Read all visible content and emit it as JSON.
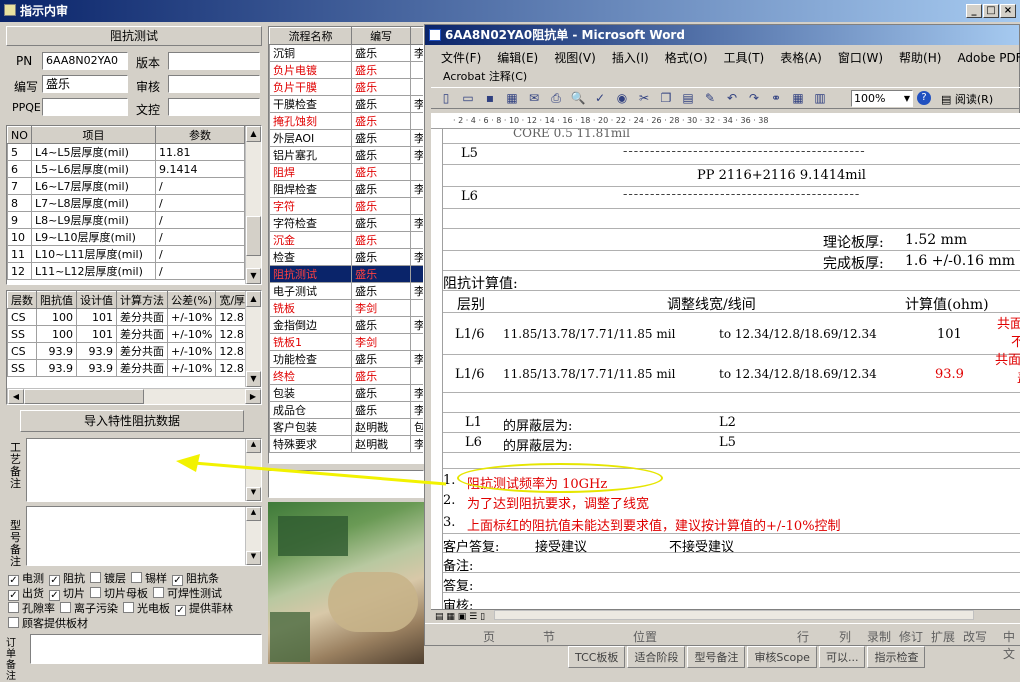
{
  "app": {
    "title": "指示内审"
  },
  "left": {
    "section_title": "阻抗测试",
    "fields": {
      "pn_label": "PN",
      "pn_value": "6AA8N02YA0",
      "version_label": "版本",
      "version_value": "",
      "writer_label": "编写",
      "writer_value": "盛乐",
      "review_label": "审核",
      "review_value": "",
      "ppqe_label": "PPQE",
      "ppqe_value": "",
      "docctrl_label": "文控",
      "docctrl_value": ""
    },
    "params_table": {
      "headers": [
        "NO",
        "项目",
        "参数"
      ],
      "rows": [
        [
          "5",
          "L4~L5层厚度(mil)",
          "11.81"
        ],
        [
          "6",
          "L5~L6层厚度(mil)",
          "9.1414"
        ],
        [
          "7",
          "L6~L7层厚度(mil)",
          "/"
        ],
        [
          "8",
          "L7~L8层厚度(mil)",
          "/"
        ],
        [
          "9",
          "L8~L9层厚度(mil)",
          "/"
        ],
        [
          "10",
          "L9~L10层厚度(mil)",
          "/"
        ],
        [
          "11",
          "L10~L11层厚度(mil)",
          "/"
        ],
        [
          "12",
          "L11~L12层厚度(mil)",
          "/"
        ]
      ]
    },
    "imp_table": {
      "headers": [
        "层数",
        "阻抗值",
        "设计值",
        "计算方法",
        "公差(%)",
        "宽/厚"
      ],
      "rows": [
        [
          "CS",
          "100",
          "101",
          "差分共面",
          "+/-10%",
          "12.8"
        ],
        [
          "SS",
          "100",
          "101",
          "差分共面",
          "+/-10%",
          "12.8"
        ],
        [
          "CS",
          "93.9",
          "93.9",
          "差分共面",
          "+/-10%",
          "12.8"
        ],
        [
          "SS",
          "93.9",
          "93.9",
          "差分共面",
          "+/-10%",
          "12.8"
        ]
      ]
    },
    "import_button": "导入特性阻抗数据",
    "remark1_label": "工艺备注",
    "remark2_label": "型号备注",
    "checks": [
      {
        "label": "电测",
        "checked": true
      },
      {
        "label": "阻抗",
        "checked": true
      },
      {
        "label": "镀层",
        "checked": false
      },
      {
        "label": "锡样",
        "checked": false
      },
      {
        "label": "阻抗条",
        "checked": true
      },
      {
        "label": "出货",
        "checked": true
      },
      {
        "label": "切片",
        "checked": true
      },
      {
        "label": "切片母板",
        "checked": false
      },
      {
        "label": "可焊性测试",
        "checked": false
      },
      {
        "label": "孔隙率",
        "checked": false
      },
      {
        "label": "离子污染",
        "checked": false
      },
      {
        "label": "光电板",
        "checked": false
      },
      {
        "label": "提供菲林",
        "checked": true
      },
      {
        "label": "顾客提供板材",
        "checked": false
      }
    ],
    "order_label": "订单备注"
  },
  "flow": {
    "headers": [
      "流程名称",
      "编写",
      ""
    ],
    "rows": [
      {
        "name": "沉铜",
        "writer": "盛乐",
        "x": "李",
        "red": false
      },
      {
        "name": "负片电镀",
        "writer": "盛乐",
        "x": "",
        "red": true
      },
      {
        "name": "负片干膜",
        "writer": "盛乐",
        "x": "",
        "red": true
      },
      {
        "name": "干膜检查",
        "writer": "盛乐",
        "x": "李",
        "red": false
      },
      {
        "name": "掩孔蚀刻",
        "writer": "盛乐",
        "x": "",
        "red": true
      },
      {
        "name": "外层AOI",
        "writer": "盛乐",
        "x": "李",
        "red": false
      },
      {
        "name": "铝片塞孔",
        "writer": "盛乐",
        "x": "李",
        "red": false
      },
      {
        "name": "阻焊",
        "writer": "盛乐",
        "x": "",
        "red": true
      },
      {
        "name": "阻焊检查",
        "writer": "盛乐",
        "x": "李",
        "red": false
      },
      {
        "name": "字符",
        "writer": "盛乐",
        "x": "",
        "red": true
      },
      {
        "name": "字符检查",
        "writer": "盛乐",
        "x": "李",
        "red": false
      },
      {
        "name": "沉金",
        "writer": "盛乐",
        "x": "",
        "red": true
      },
      {
        "name": "检查",
        "writer": "盛乐",
        "x": "李",
        "red": false
      },
      {
        "name": "阻抗测试",
        "writer": "盛乐",
        "x": "",
        "red": true,
        "selected": true
      },
      {
        "name": "电子测试",
        "writer": "盛乐",
        "x": "李",
        "red": false
      },
      {
        "name": "铣板",
        "writer": "李剑",
        "x": "",
        "red": true
      },
      {
        "name": "金指倒边",
        "writer": "盛乐",
        "x": "李",
        "red": false
      },
      {
        "name": "铣板1",
        "writer": "李剑",
        "x": "",
        "red": true
      },
      {
        "name": "功能检查",
        "writer": "盛乐",
        "x": "李",
        "red": false
      },
      {
        "name": "终检",
        "writer": "盛乐",
        "x": "",
        "red": true
      },
      {
        "name": "包装",
        "writer": "盛乐",
        "x": "李",
        "red": false
      },
      {
        "name": "成品仓",
        "writer": "盛乐",
        "x": "李",
        "red": false
      },
      {
        "name": "客户包装",
        "writer": "赵明戡",
        "x": "包",
        "red": false
      },
      {
        "name": "特殊要求",
        "writer": "赵明戡",
        "x": "李",
        "red": false
      }
    ]
  },
  "word": {
    "title": "6AA8N02YA0阻抗单 - Microsoft Word",
    "menu": [
      "文件(F)",
      "编辑(E)",
      "视图(V)",
      "插入(I)",
      "格式(O)",
      "工具(T)",
      "表格(A)",
      "窗口(W)",
      "帮助(H)",
      "Adobe PDF"
    ],
    "menu2": [
      "Acrobat 注释(C)"
    ],
    "zoom": "100%",
    "reading": "阅读(R)",
    "doc": {
      "core": "CORE  0.5  11.81mil",
      "l5": "L5",
      "pp": "PP   2116+2116  9.1414mil",
      "l6": "L6",
      "theory_label": "理论板厚:",
      "theory_value": "1.52 mm",
      "done_label": "完成板厚:",
      "done_value": "1.6 +/-0.16 mm",
      "imp_calc": "阻抗计算值:",
      "col_layer": "层别",
      "col_adjust": "调整线宽/线间",
      "col_calc": "计算值(ohm)",
      "r1_layer": "L1/6",
      "r1_from": "11.85/13.78/17.71/11.85 mil",
      "r1_to": "to 12.34/12.8/18.69/12.34",
      "r1_val": "101",
      "r1_note": "共面",
      "r1_note2": "不",
      "r2_layer": "L1/6",
      "r2_from": "11.85/13.78/17.71/11.85 mil",
      "r2_to": "to 12.34/12.8/18.69/12.34",
      "r2_val": "93.9",
      "r2_note": "共面",
      "r2_note2": "盖",
      "shield1_layer": "L1",
      "shield1_label": "的屏蔽层为:",
      "shield1_value": "L2",
      "shield2_layer": "L6",
      "shield2_label": "的屏蔽层为:",
      "shield2_value": "L5",
      "note1_num": "1.",
      "note1": "阻抗测试频率为 10GHz",
      "note2_num": "2.",
      "note2": "为了达到阻抗要求，调整了线宽",
      "note3_num": "3.",
      "note3": "上面标红的阻抗值未能达到要求值，建议按计算值的+/-10%控制",
      "reply_label": "客户答复:",
      "accept": "接受建议",
      "reject": "不接受建议",
      "remark": "备注:",
      "answer": "答复:",
      "audit": "审核:"
    },
    "status": [
      "页",
      "节",
      "位置",
      "行",
      "列",
      "录制",
      "修订",
      "扩展",
      "改写",
      "中文"
    ]
  },
  "bottom_strip": [
    "TCC板板",
    "适合阶段",
    "型号备注",
    "审核Scope",
    "可以...",
    "指示检查"
  ],
  "colors": {
    "title_blue": "#0a246a",
    "red": "#e00000",
    "selection": "#0a246a",
    "highlight": "#ffff80",
    "arrow": "#f2f200"
  }
}
